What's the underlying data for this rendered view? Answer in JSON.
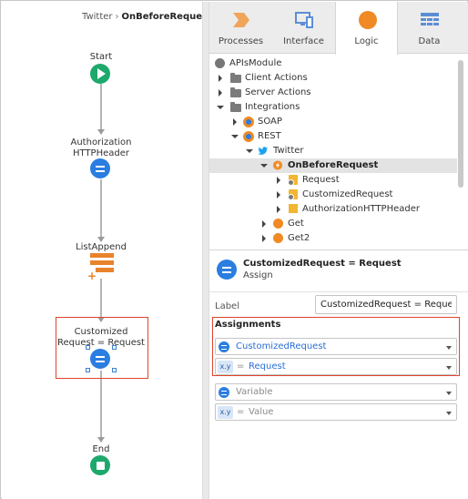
{
  "breadcrumb": {
    "parent": "Twitter",
    "separator": "›",
    "current": "OnBeforeRequest"
  },
  "flow": {
    "nodes": [
      {
        "label": "Start",
        "kind": "start"
      },
      {
        "label": "Authorization\nHTTPHeader",
        "kind": "assign"
      },
      {
        "label": "ListAppend",
        "kind": "listappend"
      },
      {
        "label": "Customized\nRequest = Request",
        "kind": "assign",
        "selected": true
      },
      {
        "label": "End",
        "kind": "end"
      }
    ]
  },
  "tabs": [
    {
      "label": "Processes",
      "icon": "process-chevron-icon"
    },
    {
      "label": "Interface",
      "icon": "monitor-phone-icon"
    },
    {
      "label": "Logic",
      "icon": "logic-circle-icon",
      "active": true
    },
    {
      "label": "Data",
      "icon": "data-grid-icon"
    }
  ],
  "tree": {
    "items": [
      {
        "label": "APIsModule",
        "icon": "module-icon"
      },
      {
        "label": "Client Actions",
        "icon": "folder-icon"
      },
      {
        "label": "Server Actions",
        "icon": "folder-icon"
      },
      {
        "label": "Integrations",
        "icon": "folder-icon"
      },
      {
        "label": "SOAP",
        "icon": "soap-icon"
      },
      {
        "label": "REST",
        "icon": "rest-icon"
      },
      {
        "label": "Twitter",
        "icon": "twitter-bird-icon"
      },
      {
        "label": "OnBeforeRequest",
        "icon": "callback-icon",
        "selected": true
      },
      {
        "label": "Request",
        "icon": "structure-icon"
      },
      {
        "label": "CustomizedRequest",
        "icon": "structure-icon"
      },
      {
        "label": "AuthorizationHTTPHeader",
        "icon": "structure-icon"
      },
      {
        "label": "Get",
        "icon": "method-icon"
      },
      {
        "label": "Get2",
        "icon": "method-icon"
      }
    ]
  },
  "props": {
    "title": "CustomizedRequest = Request",
    "subtitle": "Assign",
    "label_caption": "Label",
    "label_value": "CustomizedRequest = Request",
    "assignments_title": "Assignments",
    "assign_variable": "CustomizedRequest",
    "assign_value": "Request",
    "empty_variable_placeholder": "Variable",
    "empty_value_placeholder": "Value",
    "xy_badge": "x.y",
    "equals_sign": "="
  },
  "colors": {
    "accent_red": "#e0442c",
    "assign_blue": "#2a7de1",
    "start_green": "#1da86c",
    "logic_orange": "#f08a24"
  }
}
